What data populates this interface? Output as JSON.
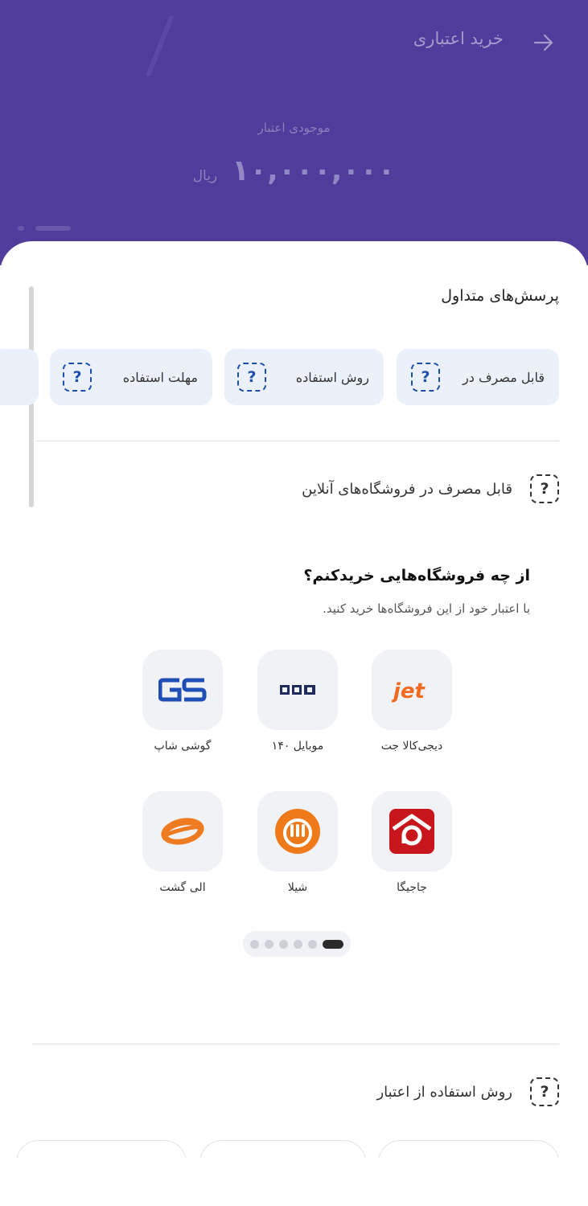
{
  "header": {
    "title": "خرید اعتباری",
    "balance_label": "موجودی اعتبار",
    "balance_amount": "۱۰,۰۰۰,۰۰۰",
    "balance_unit": "ریال",
    "background_color": "#503c9b",
    "back_icon": "arrow-right-icon"
  },
  "faq": {
    "title": "پرسش‌های متداول",
    "chips": [
      {
        "label": "قابل مصرف در",
        "icon": "question-dashed-icon"
      },
      {
        "label": "روش استفاده",
        "icon": "question-dashed-icon"
      },
      {
        "label": "مهلت استفاده",
        "icon": "question-dashed-icon"
      }
    ],
    "accent_color": "#1e4fa8",
    "chip_bg_color": "#ebf1fa"
  },
  "section_online": {
    "question": "قابل مصرف در فروشگاه‌های آنلاین",
    "stores_title": "از چه فروشگاه‌هایی خریدکنم؟",
    "stores_subtitle": "با اعتبار خود از این فروشگاه‌ها خرید کنید.",
    "stores": [
      {
        "name": "دیجی‌کالا جت",
        "icon": "digikala-jet-logo"
      },
      {
        "name": "موبایل ۱۴۰",
        "icon": "mobile140-logo"
      },
      {
        "name": "گوشی شاپ",
        "icon": "gooshishop-logo"
      },
      {
        "name": "جاجیگا",
        "icon": "jajiga-logo"
      },
      {
        "name": "شیلا",
        "icon": "shila-logo"
      },
      {
        "name": "الی گشت",
        "icon": "eligasht-logo"
      }
    ],
    "pager": {
      "count": 6,
      "active_index": 5
    }
  },
  "section_usage": {
    "question": "روش استفاده از اعتبار"
  }
}
